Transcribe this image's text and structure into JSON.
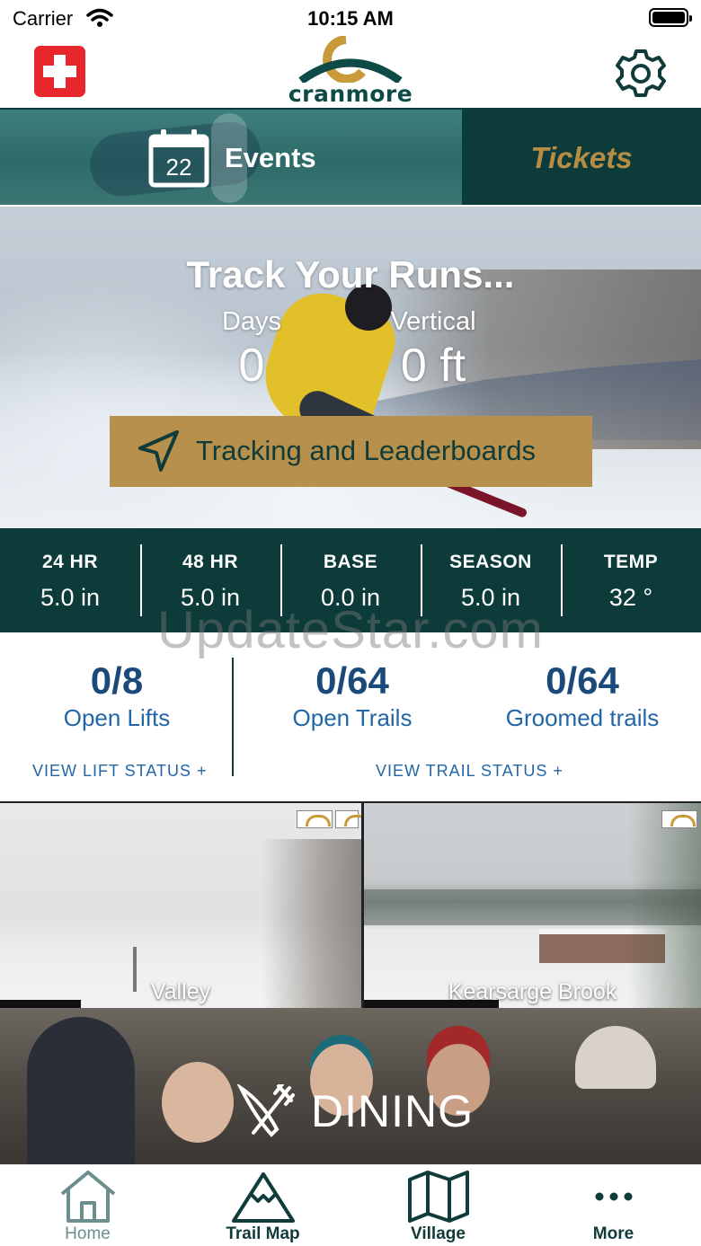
{
  "status_bar": {
    "carrier": "Carrier",
    "time": "10:15 AM"
  },
  "header": {
    "logo_text": "cranmore"
  },
  "tiles": {
    "calendar_day": "22",
    "events_label": "Events",
    "tickets_label": "Tickets"
  },
  "hero": {
    "title": "Track Your Runs...",
    "days_label": "Days",
    "days_value": "0",
    "vertical_label": "Vertical",
    "vertical_value": "0 ft",
    "tracking_button": "Tracking and Leaderboards"
  },
  "snow_report": [
    {
      "label": "24 HR",
      "value": "5.0 in"
    },
    {
      "label": "48 HR",
      "value": "5.0 in"
    },
    {
      "label": "BASE",
      "value": "0.0 in"
    },
    {
      "label": "SEASON",
      "value": "5.0 in"
    },
    {
      "label": "TEMP",
      "value": "32 °"
    }
  ],
  "status_panel": {
    "lifts_value": "0/8",
    "lifts_label": "Open Lifts",
    "trails_value": "0/64",
    "trails_label": "Open Trails",
    "groomed_value": "0/64",
    "groomed_label": "Groomed trails",
    "view_lift_status": "VIEW LIFT STATUS +",
    "view_trail_status": "VIEW TRAIL STATUS +"
  },
  "webcams": [
    {
      "label": "Valley"
    },
    {
      "label": "Kearsarge Brook"
    }
  ],
  "dining": {
    "label": "DINING"
  },
  "tab_bar": [
    {
      "label": "Home",
      "icon": "home-icon",
      "active": true
    },
    {
      "label": "Trail Map",
      "icon": "mountain-icon",
      "active": false
    },
    {
      "label": "Village",
      "icon": "map-icon",
      "active": false
    },
    {
      "label": "More",
      "icon": "more-icon",
      "active": false
    }
  ],
  "watermark": "UpdateStar.com",
  "colors": {
    "brand_dark_teal": "#0d3b3a",
    "brand_gold": "#b7904b",
    "metric_blue": "#1b4a7a",
    "first_aid_red": "#e8262e"
  }
}
